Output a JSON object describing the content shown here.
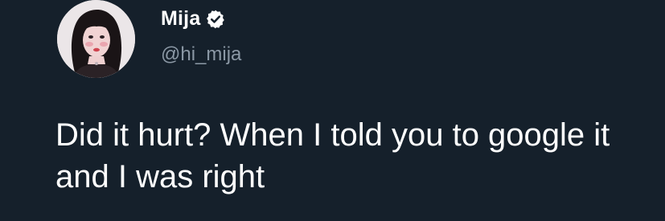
{
  "author": {
    "display_name": "Mija",
    "handle": "@hi_mija",
    "verified": true,
    "avatar_icon": "profile-photo"
  },
  "tweet": {
    "text": "Did it hurt? When I told you to google it and I was right"
  },
  "colors": {
    "background": "#15202b",
    "text_primary": "#ffffff",
    "text_secondary": "#8b98a5",
    "verified_badge": "#ffffff"
  }
}
